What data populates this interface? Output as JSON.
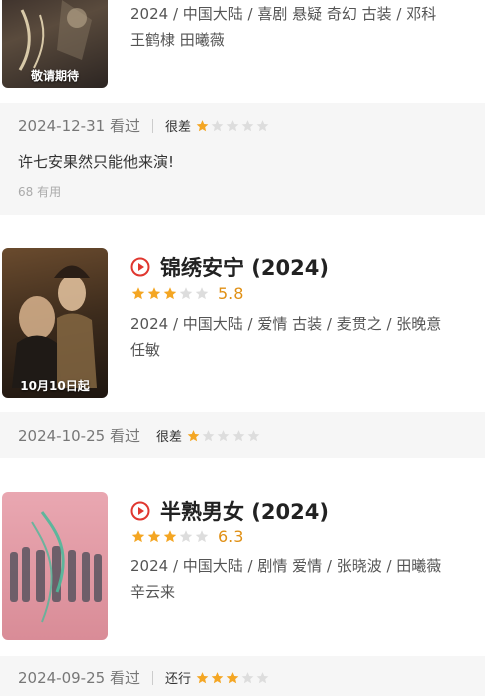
{
  "colors": {
    "star_filled": "#f4a623",
    "star_empty": "#dddddd",
    "accent": "#e0372f",
    "card_bg": "#f6f6f6"
  },
  "items": [
    {
      "meta_line1": "2024 / 中国大陆 / 喜剧 悬疑 奇幻 古装 / 邓科",
      "meta_line2": "王鹤棣 田曦薇",
      "poster_caption": "敬请期待",
      "review": {
        "date": "2024-12-31 看过",
        "verdict": "很差",
        "stars": 1,
        "comment": "许七安果然只能他来演!",
        "useful": "68 有用"
      }
    },
    {
      "title": "锦绣安宁 (2024)",
      "rating_stars": 3,
      "score": "5.8",
      "meta_line1": "2024 / 中国大陆 / 爱情 古装 / 麦贯之 / 张晚意",
      "meta_line2": "任敏",
      "poster_caption": "10月10日起",
      "review": {
        "date": "2024-10-25 看过",
        "verdict": "很差",
        "stars": 1
      }
    },
    {
      "title": "半熟男女 (2024)",
      "rating_stars": 3,
      "score": "6.3",
      "meta_line1": "2024 / 中国大陆 / 剧情 爱情 / 张晓波 / 田曦薇",
      "meta_line2": "辛云来",
      "review": {
        "date": "2024-09-25 看过",
        "verdict": "还行",
        "stars": 3
      }
    }
  ]
}
